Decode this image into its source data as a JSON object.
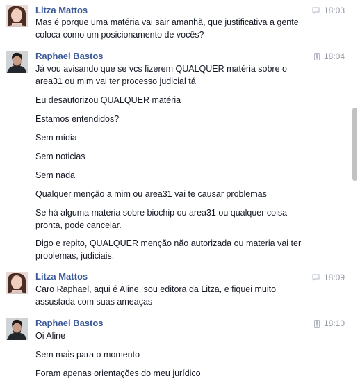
{
  "messages": [
    {
      "sender": "Litza Mattos",
      "time": "18:03",
      "via": "chat-icon",
      "avatar": "avatar-litza",
      "lines": [
        "Mas é porque uma matéria vai sair amanhã, que justificativa a gente",
        "coloca como um posicionamento de vocês?"
      ]
    },
    {
      "sender": "Raphael Bastos",
      "time": "18:04",
      "via": "mobile-icon",
      "avatar": "avatar-raphael",
      "lines": [
        "Já vou avisando que se vcs fizerem QUALQUER matéria sobre o",
        "area31 ou mim vai ter processo judicial tá",
        "Eu desautorizou QUALQUER matéria",
        "Estamos entendidos?",
        "Sem mídia",
        "Sem noticias",
        "Sem nada",
        "Qualquer menção a mim ou area31 vai te causar problemas",
        "Se há alguma materia sobre biochip ou area31 ou qualquer coisa",
        "pronta, pode cancelar.",
        "Digo e repito, QUALQUER menção não autorizada ou materia vai ter",
        "problemas, judiciais."
      ]
    },
    {
      "sender": "Litza Mattos",
      "time": "18:09",
      "via": "chat-icon",
      "avatar": "avatar-litza",
      "lines": [
        "Caro Raphael, aqui é Aline, sou editora da Litza, e fiquei muito",
        "assustada com suas ameaças"
      ]
    },
    {
      "sender": "Raphael Bastos",
      "time": "18:10",
      "via": "mobile-icon",
      "avatar": "avatar-raphael",
      "lines": [
        "Oi Aline",
        "Sem mais para o momento",
        "Foram apenas orientações do meu jurídico"
      ]
    }
  ],
  "colors": {
    "sender": "#3b5998",
    "text": "#141823",
    "time": "#9197a3",
    "scrollbar": "#c2c2c2"
  }
}
